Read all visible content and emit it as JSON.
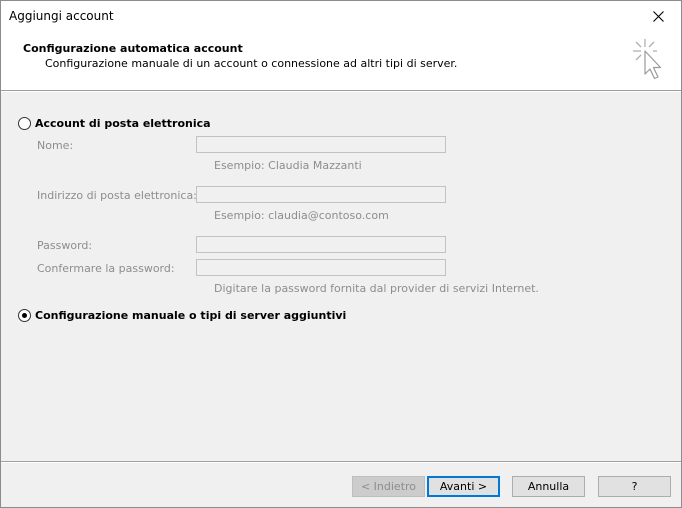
{
  "window": {
    "title": "Aggiungi account"
  },
  "header": {
    "title": "Configurazione automatica account",
    "subtitle": "Configurazione manuale di un account o connessione ad altri tipi di server."
  },
  "email_account": {
    "option_label": "Account di posta elettronica",
    "selected": false,
    "name_label": "Nome:",
    "name_value": "",
    "name_hint": "Esempio: Claudia Mazzanti",
    "email_label": "Indirizzo di posta elettronica:",
    "email_value": "",
    "email_hint": "Esempio: claudia@contoso.com",
    "password_label": "Password:",
    "confirm_password_label": "Confermare la password:",
    "password_hint": "Digitare la password fornita dal provider di servizi Internet."
  },
  "manual_config": {
    "option_label": "Configurazione manuale o tipi di server aggiuntivi",
    "selected": true
  },
  "buttons": {
    "back": "< Indietro",
    "next": "Avanti >",
    "cancel": "Annulla",
    "help": "?"
  },
  "colors": {
    "accent": "#0078d7",
    "disabled_text": "#8d8d8d",
    "background": "#f0f0f0"
  }
}
